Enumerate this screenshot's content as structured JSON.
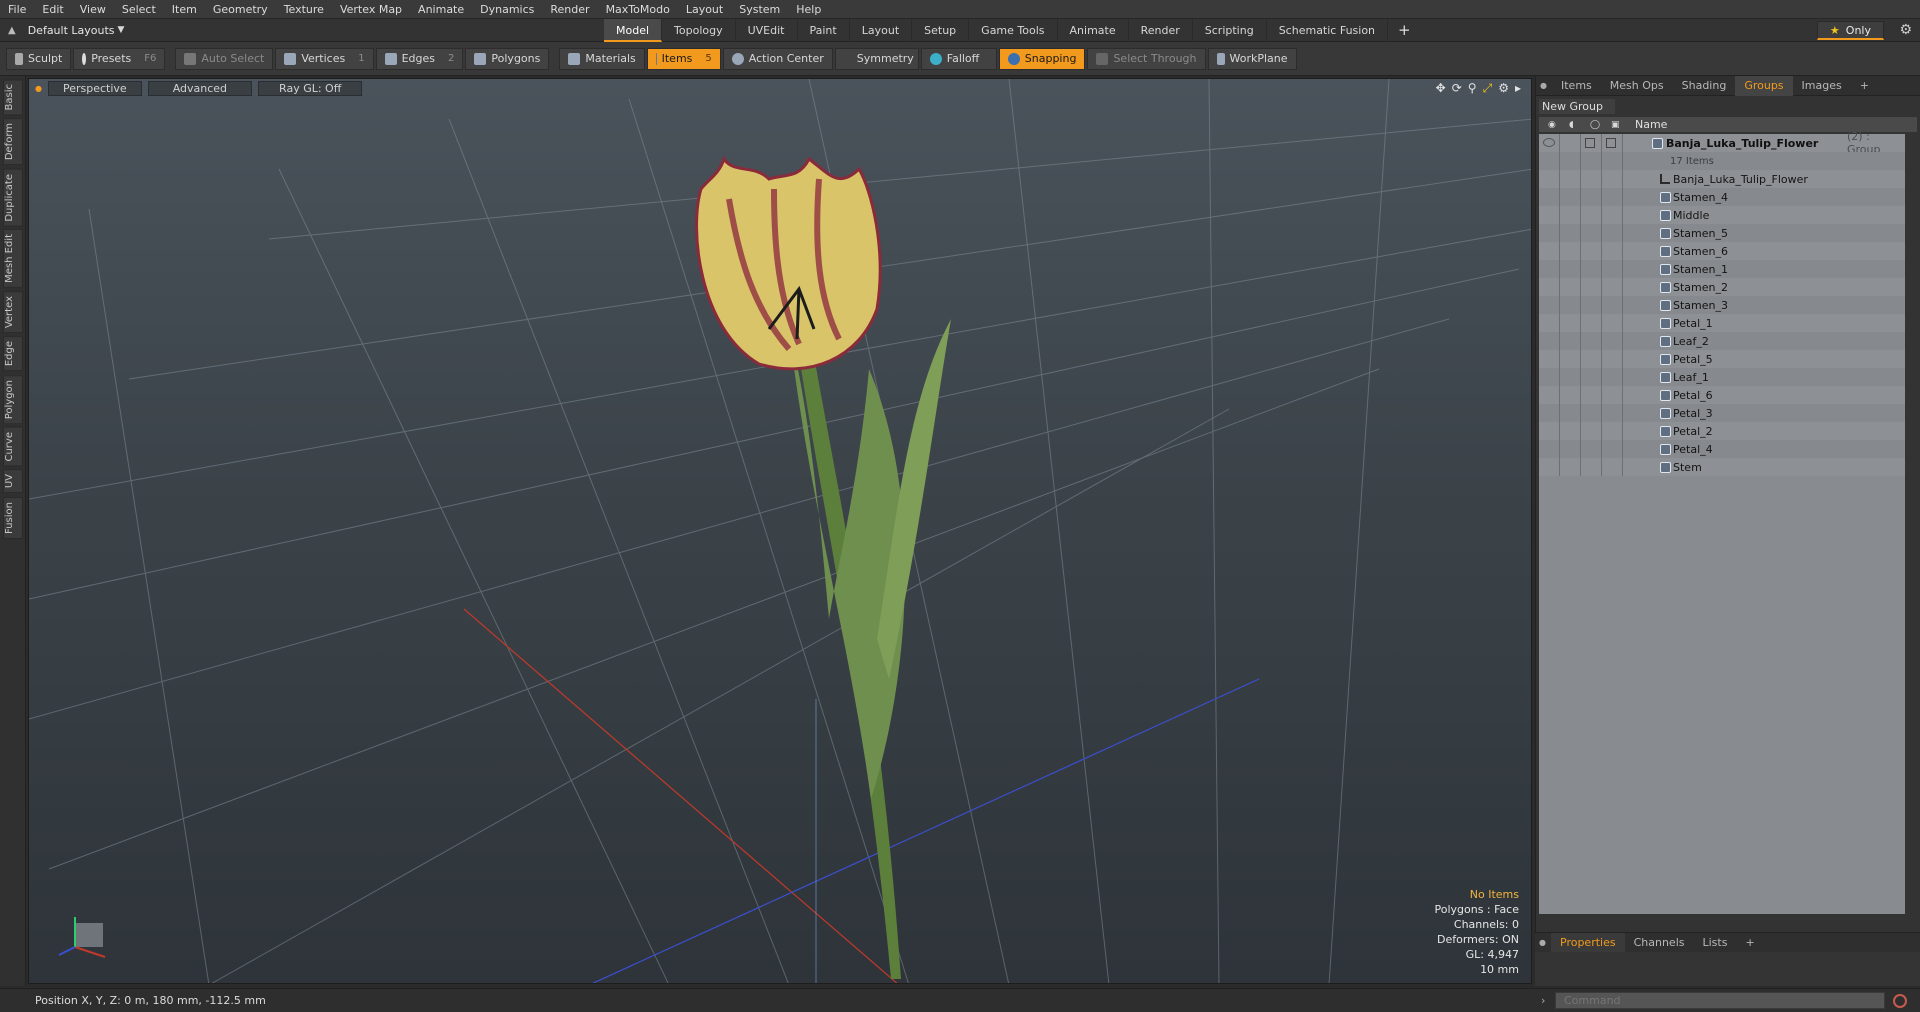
{
  "menu": [
    "File",
    "Edit",
    "View",
    "Select",
    "Item",
    "Geometry",
    "Texture",
    "Vertex Map",
    "Animate",
    "Dynamics",
    "Render",
    "MaxToModo",
    "Layout",
    "System",
    "Help"
  ],
  "layout_selector": "Default Layouts",
  "mode_tabs": [
    "Model",
    "Topology",
    "UVEdit",
    "Paint",
    "Layout",
    "Setup",
    "Game Tools",
    "Animate",
    "Render",
    "Scripting",
    "Schematic Fusion"
  ],
  "active_mode": "Model",
  "only_label": "Only",
  "toolbar": {
    "sculpt": "Sculpt",
    "presets": "Presets",
    "presets_key": "F6",
    "auto_select": "Auto Select",
    "vertices": "Vertices",
    "vertices_key": "1",
    "edges": "Edges",
    "edges_key": "2",
    "polygons": "Polygons",
    "materials": "Materials",
    "items": "Items",
    "items_key": "5",
    "action_center": "Action Center",
    "symmetry": "Symmetry",
    "falloff": "Falloff",
    "snapping": "Snapping",
    "select_through": "Select Through",
    "workplane": "WorkPlane"
  },
  "left_tabs": [
    "Basic",
    "Deform",
    "Duplicate",
    "Mesh Edit",
    "Vertex",
    "Edge",
    "Polygon",
    "Curve",
    "UV",
    "Fusion"
  ],
  "viewport": {
    "view": "Perspective",
    "shading": "Advanced",
    "raygl": "Ray GL: Off",
    "info": {
      "selection": "No Items",
      "polygons": "Polygons : Face",
      "channels": "Channels: 0",
      "deformers": "Deformers: ON",
      "gl": "GL: 4,947",
      "grid": "10 mm"
    }
  },
  "right_tabs": [
    "Items",
    "Mesh Ops",
    "Shading",
    "Groups",
    "Images"
  ],
  "active_right_tab": "Groups",
  "new_group": "New Group",
  "list_header": "Name",
  "group": {
    "name": "Banja_Luka_Tulip_Flower",
    "suffix": "(2) : Group",
    "count": "17 Items"
  },
  "items": [
    {
      "name": "Banja_Luka_Tulip_Flower",
      "type": "locator"
    },
    {
      "name": "Stamen_4",
      "type": "mesh"
    },
    {
      "name": "Middle",
      "type": "mesh"
    },
    {
      "name": "Stamen_5",
      "type": "mesh"
    },
    {
      "name": "Stamen_6",
      "type": "mesh"
    },
    {
      "name": "Stamen_1",
      "type": "mesh"
    },
    {
      "name": "Stamen_2",
      "type": "mesh"
    },
    {
      "name": "Stamen_3",
      "type": "mesh"
    },
    {
      "name": "Petal_1",
      "type": "mesh"
    },
    {
      "name": "Leaf_2",
      "type": "mesh"
    },
    {
      "name": "Petal_5",
      "type": "mesh"
    },
    {
      "name": "Leaf_1",
      "type": "mesh"
    },
    {
      "name": "Petal_6",
      "type": "mesh"
    },
    {
      "name": "Petal_3",
      "type": "mesh"
    },
    {
      "name": "Petal_2",
      "type": "mesh"
    },
    {
      "name": "Petal_4",
      "type": "mesh"
    },
    {
      "name": "Stem",
      "type": "mesh"
    }
  ],
  "prop_tabs": [
    "Properties",
    "Channels",
    "Lists"
  ],
  "active_prop_tab": "Properties",
  "status": "Position X, Y, Z:  0 m, 180 mm, -112.5 mm",
  "command_placeholder": "Command",
  "colors": {
    "accent": "#f29a1d",
    "list_bg": "#888c90",
    "axis_x": "#c0392b",
    "axis_z": "#3b4fd0"
  }
}
